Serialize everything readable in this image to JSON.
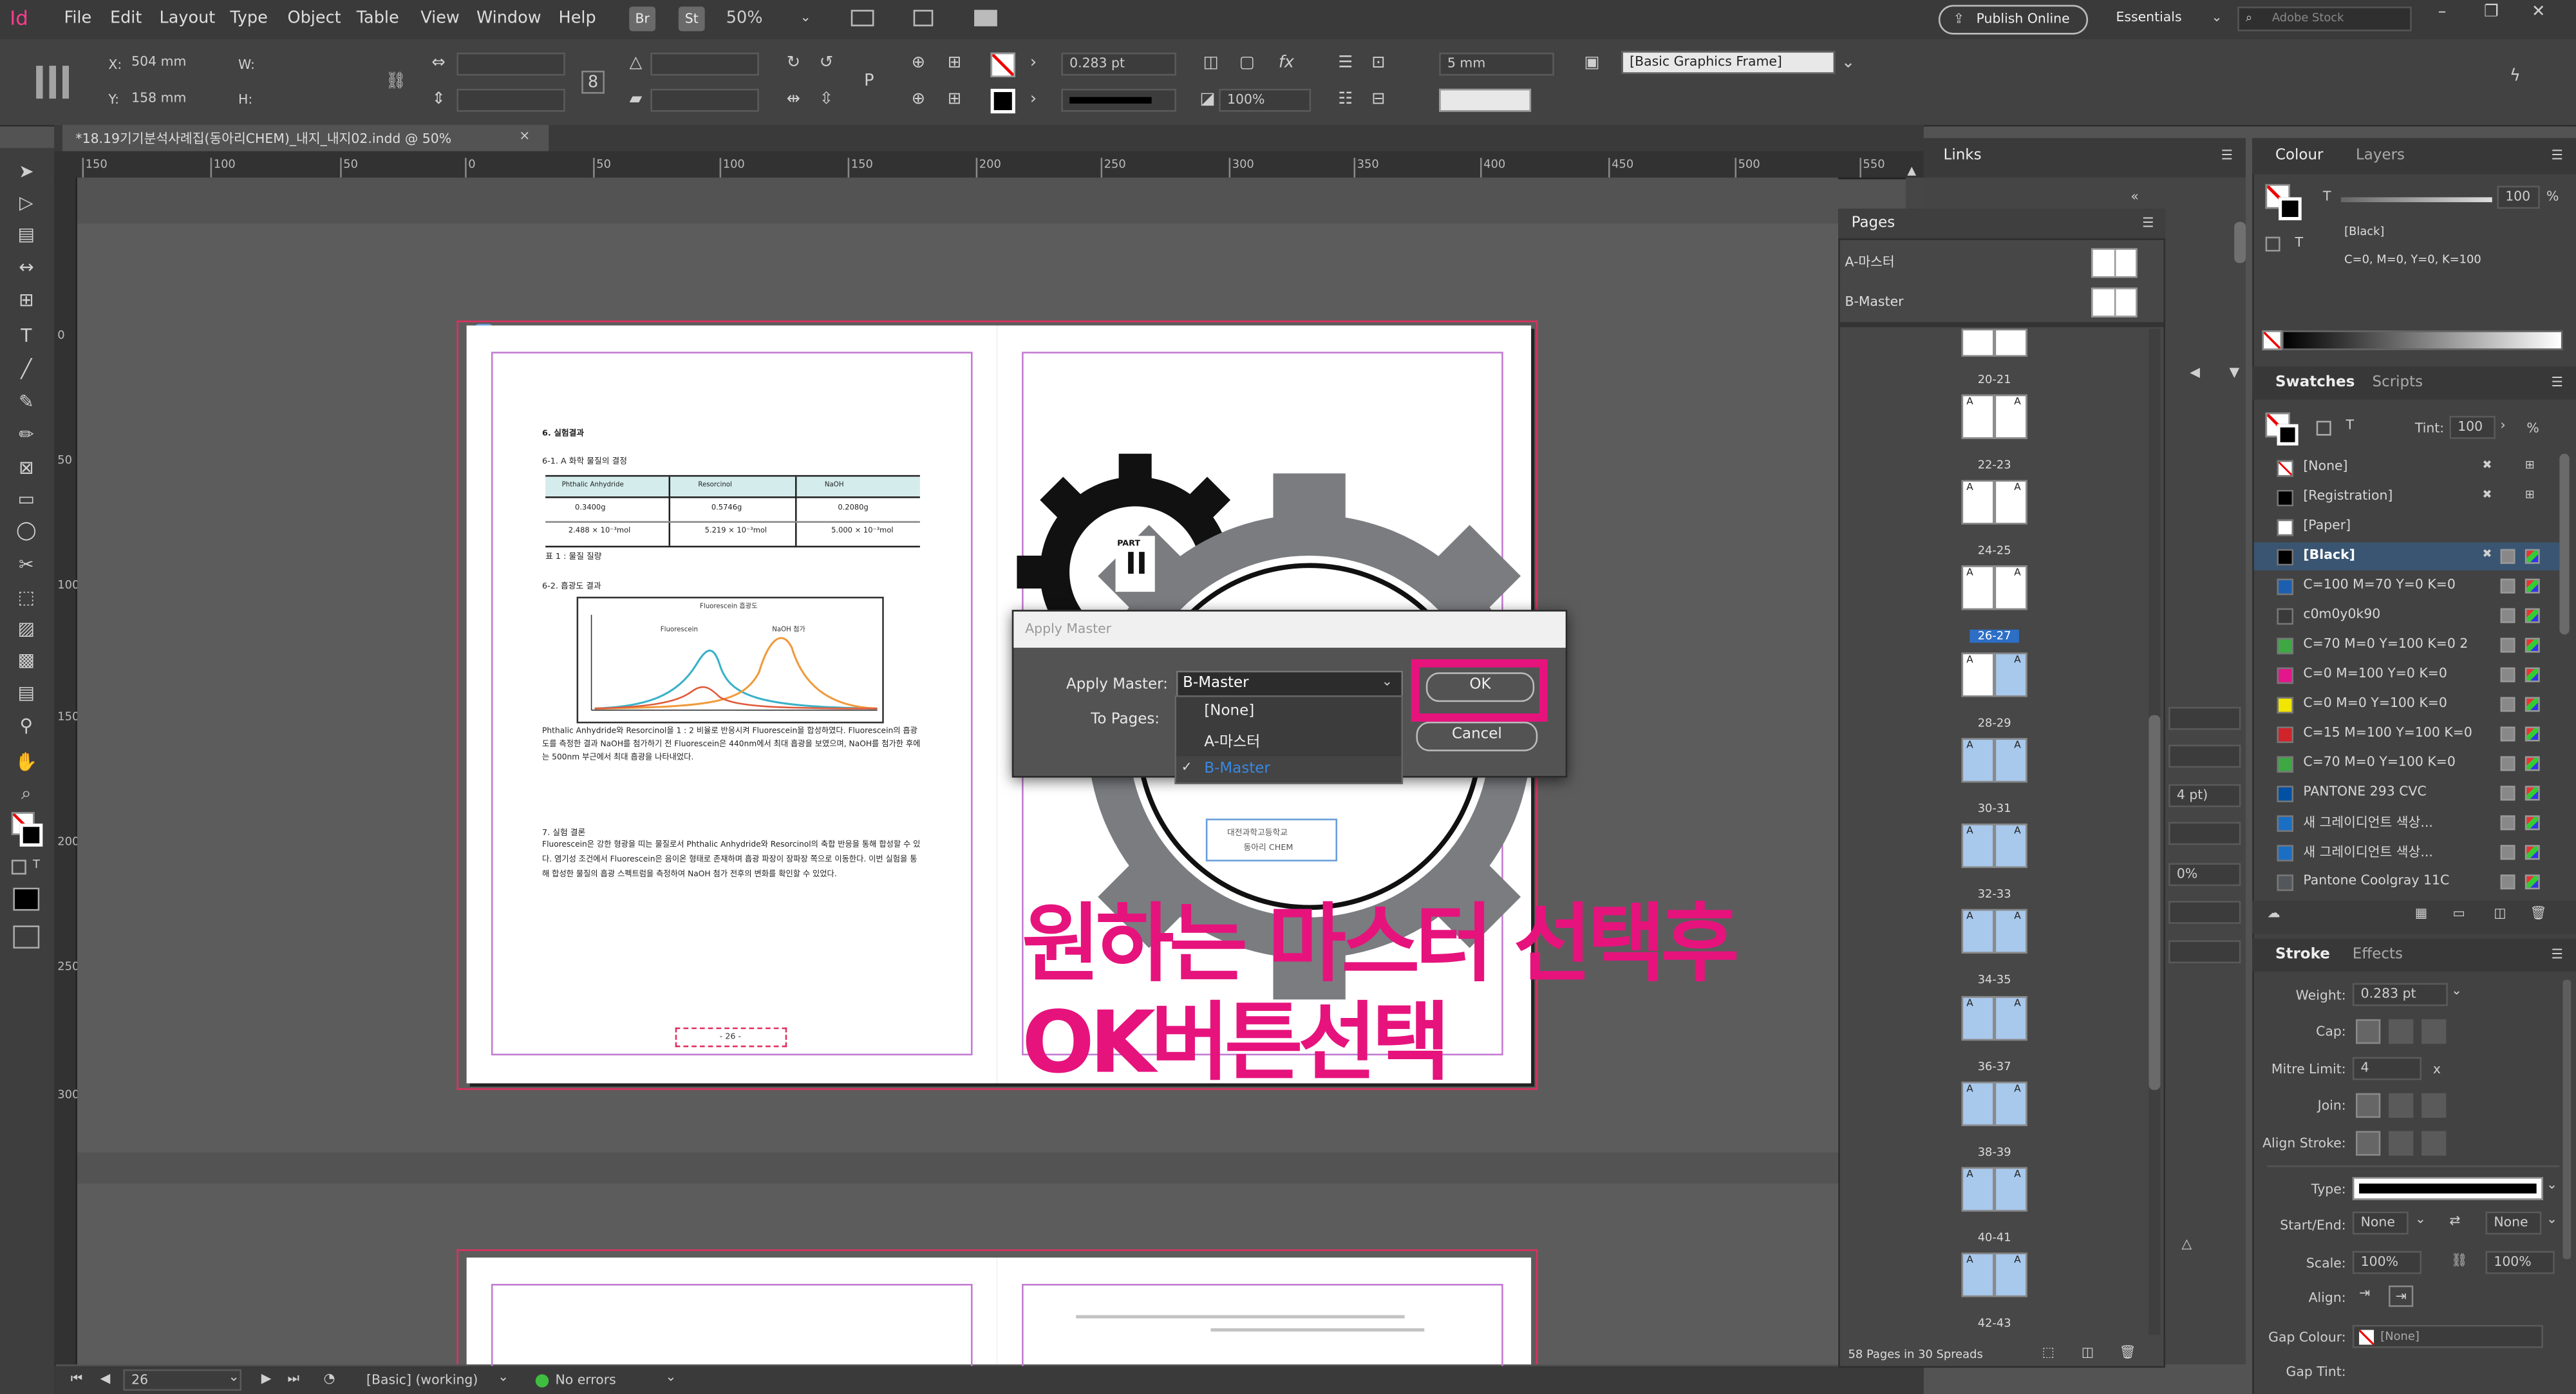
{
  "app": {
    "logo": "Id"
  },
  "menu": [
    "File",
    "Edit",
    "Layout",
    "Type",
    "Object",
    "Table",
    "View",
    "Window",
    "Help"
  ],
  "toolbar_top": {
    "br": "Br",
    "st": "St",
    "zoom": "50%",
    "publish": "Publish Online",
    "workspace": "Essentials",
    "search_placeholder": "Adobe Stock"
  },
  "control": {
    "x_label": "X:",
    "x": "504 mm",
    "y_label": "Y:",
    "y": "158 mm",
    "w_label": "W:",
    "h_label": "H:",
    "stroke_weight": "0.283 pt",
    "scale": "100%",
    "gap": "5 mm",
    "frame_style": "[Basic Graphics Frame]"
  },
  "document": {
    "tab_title": "*18.19기기분석사례집(동아리CHEM)_내지_내지02.indd @ 50%",
    "tab_close": "×"
  },
  "ruler_h": [
    "150",
    "100",
    "50",
    "0",
    "50",
    "100",
    "150",
    "200",
    "250",
    "300",
    "350",
    "400",
    "450",
    "500",
    "550"
  ],
  "ruler_v": [
    "0",
    "50",
    "100",
    "150",
    "200",
    "250",
    "300"
  ],
  "left_page": {
    "h1": "6. 실험결과",
    "h1_sub": "6-1. A 화학 물질의 결정",
    "table_head": [
      "Phthalic Anhydride",
      "Resorcinol",
      "NaOH"
    ],
    "table_row1": [
      "0.3400g",
      "0.5746g",
      "0.2080g"
    ],
    "table_row2": [
      "2.488 × 10⁻³mol",
      "5.219 × 10⁻³mol",
      "5.000 × 10⁻³mol"
    ],
    "table_caption": "표 1 : 물질 질량",
    "h2": "6-2. 흡광도 결과",
    "chart_title": "Fluorescein 흡광도",
    "legend1": "Fluorescein",
    "legend2": "NaOH 첨가",
    "body1": "Phthalic Anhydride와 Resorcinol을 1 : 2 비율로 반응시켜 Fluorescein을 합성하였다. Fluorescein의 흡광도를 측정한 결과 NaOH를 첨가하기 전 Fluorescein은 440nm에서 최대 흡광을 보였으며, NaOH를 첨가한 후에는 500nm 부근에서 최대 흡광을 나타내었다.",
    "h3": "7. 실험 결론",
    "body2": "Fluorescein은 강한 형광을 띠는 물질로서 Phthalic Anhydride와 Resorcinol의 축합 반응을 통해 합성할 수 있다. 염기성 조건에서 Fluorescein은 음이온 형태로 존재하며 흡광 파장이 장파장 쪽으로 이동한다. 이번 실험을 통해 합성한 물질의 흡광 스펙트럼을 측정하여 NaOH 첨가 전후의 변화를 확인할 수 있었다.",
    "page_number": "- 26 -"
  },
  "right_page": {
    "part_label": "PART",
    "part_number": "II",
    "school": "대전과학고등학교",
    "club": "동아리 CHEM"
  },
  "dialog": {
    "title": "Apply Master",
    "apply_label": "Apply Master:",
    "apply_value": "B-Master",
    "pages_label": "To Pages:",
    "options": [
      "[None]",
      "A-마스터",
      "B-Master"
    ],
    "selected_option": "B-Master",
    "ok": "OK",
    "cancel": "Cancel"
  },
  "annotation": {
    "line1": "원하는 마스터 선택후",
    "line2": "OK버튼선택"
  },
  "links_panel": {
    "title": "Links"
  },
  "pages_panel": {
    "title": "Pages",
    "master_a": "A-마스터",
    "master_b": "B-Master",
    "labels": [
      "20-21",
      "22-23",
      "24-25",
      "26-27",
      "28-29",
      "30-31",
      "32-33",
      "34-35",
      "36-37",
      "38-39",
      "40-41",
      "42-43"
    ],
    "thumb_letter": "A",
    "footer": "58 Pages in 30 Spreads"
  },
  "colour_panel": {
    "tab1": "Colour",
    "tab2": "Layers",
    "tint": "100",
    "swatch_name": "[Black]",
    "values": "C=0, M=0, Y=0, K=100",
    "fill_t": "T"
  },
  "swatches_panel": {
    "tab1": "Swatches",
    "tab2": "Scripts",
    "tint_label": "Tint:",
    "tint": "100",
    "pct": "%",
    "t": "T",
    "items": [
      {
        "name": "[None]",
        "color": "none"
      },
      {
        "name": "[Registration]",
        "color": "#000000"
      },
      {
        "name": "[Paper]",
        "color": "#ffffff"
      },
      {
        "name": "[Black]",
        "color": "#000000"
      },
      {
        "name": "C=100 M=70 Y=0 K=0",
        "color": "#1c5fb0"
      },
      {
        "name": "c0m0y0k90",
        "color": "#3a3a3a"
      },
      {
        "name": "C=70 M=0 Y=100 K=0 2",
        "color": "#3ea845"
      },
      {
        "name": "C=0 M=100 Y=0 K=0",
        "color": "#e3168c"
      },
      {
        "name": "C=0 M=0 Y=100 K=0",
        "color": "#f2e500"
      },
      {
        "name": "C=15 M=100 Y=100 K=0",
        "color": "#d1232a"
      },
      {
        "name": "C=70 M=0 Y=100 K=0",
        "color": "#3ea845"
      },
      {
        "name": "PANTONE 293 CVC",
        "color": "#0050a4"
      },
      {
        "name": "새 그레이디언트 색상...",
        "color": "#1a6fc4"
      },
      {
        "name": "새 그레이디언트 색상...",
        "color": "#1a6fc4"
      },
      {
        "name": "Pantone Coolgray 11C",
        "color": "#53565a"
      }
    ]
  },
  "stroke_panel": {
    "tab1": "Stroke",
    "tab2": "Effects",
    "weight_label": "Weight:",
    "weight": "0.283 pt",
    "cap_label": "Cap:",
    "mitre_label": "Mitre Limit:",
    "mitre": "4",
    "mitre_x": "x",
    "join_label": "Join:",
    "align_label": "Align Stroke:",
    "type_label": "Type:",
    "startend_label": "Start/End:",
    "start": "None",
    "end": "None",
    "scale_label": "Scale:",
    "scale1": "100%",
    "scale2": "100%",
    "align2_label": "Align:",
    "gapcolour_label": "Gap Colour:",
    "gapcolour": "[None]",
    "gaptint_label": "Gap Tint:"
  },
  "mid_panel": {
    "a": "4 pt)",
    "b": "0%"
  },
  "status": {
    "page": "26",
    "style": "[Basic] (working)",
    "errors": "No errors"
  },
  "colors": {
    "accent": "#e6137d",
    "bg": "#535353",
    "panel": "#424242"
  }
}
